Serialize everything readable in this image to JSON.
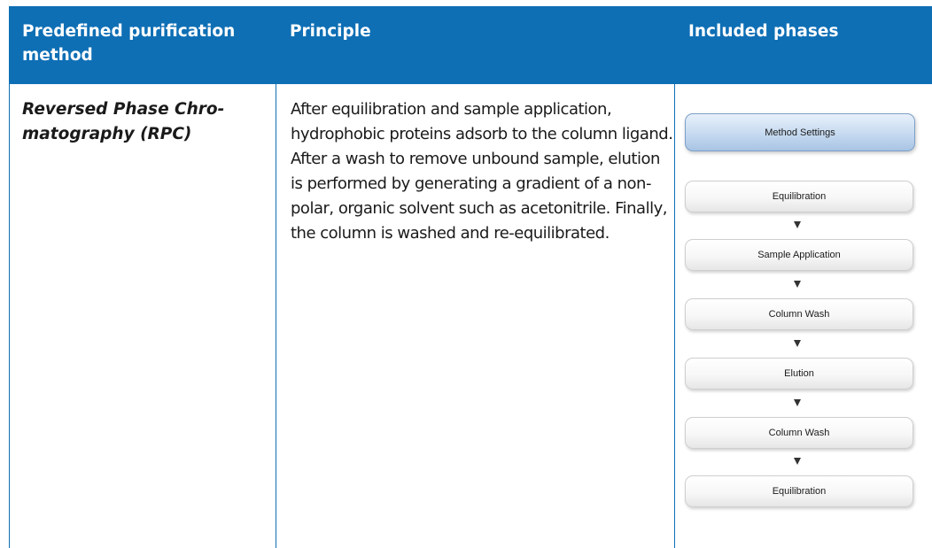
{
  "header": {
    "col1": "Predefined purification method",
    "col2": "Principle",
    "col3": "Included phases"
  },
  "row": {
    "method_name": "Reversed Phase Chro-matography (RPC)",
    "principle": "After equilibration and sample application, hydrophobic proteins adsorb to the column ligand. After a wash to remove unbound sample, elution is performed by generating a gradient of a non-polar, organic solvent such as acetonitrile. Finally, the column is washed and re-equilibrated.",
    "flow": {
      "settings": "Method Settings",
      "phases": [
        "Equilibration",
        "Sample Application",
        "Column Wash",
        "Elution",
        "Column Wash",
        "Equilibration"
      ]
    }
  },
  "colors": {
    "header_bg": "#0e6fb5",
    "header_text": "#ffffff",
    "settings_box": "#c9dcf1"
  }
}
